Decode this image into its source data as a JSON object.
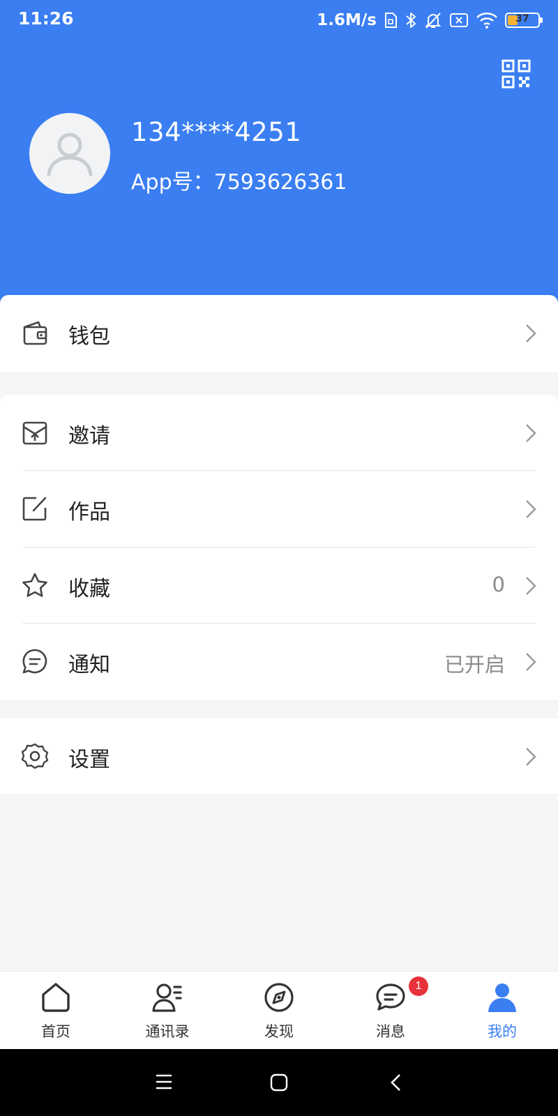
{
  "status_bar": {
    "time": "11:26",
    "network_speed": "1.6M/s",
    "battery_level": "37",
    "icons": [
      "sim-icon",
      "bluetooth-icon",
      "mute-icon",
      "no-sim-icon",
      "wifi-icon",
      "battery-icon"
    ]
  },
  "profile": {
    "phone": "134****4251",
    "app_id": "App号：7593626361",
    "qr_icon": "qr-code-icon",
    "avatar_icon": "user-placeholder-icon"
  },
  "menu": {
    "wallet": {
      "label": "钱包",
      "icon": "wallet-icon"
    },
    "invite": {
      "label": "邀请",
      "icon": "invite-icon"
    },
    "works": {
      "label": "作品",
      "icon": "edit-icon"
    },
    "favorites": {
      "label": "收藏",
      "value": "0",
      "icon": "star-icon"
    },
    "notifications": {
      "label": "通知",
      "value": "已开启",
      "icon": "chat-bubble-icon"
    },
    "settings": {
      "label": "设置",
      "icon": "gear-icon"
    }
  },
  "tabs": [
    {
      "label": "首页",
      "icon": "home-icon"
    },
    {
      "label": "通讯录",
      "icon": "contacts-icon"
    },
    {
      "label": "发现",
      "icon": "discover-icon"
    },
    {
      "label": "消息",
      "icon": "message-icon",
      "badge": "1"
    },
    {
      "label": "我的",
      "icon": "profile-icon",
      "active": true
    }
  ],
  "colors": {
    "primary": "#3a7ef2",
    "badge": "#e8323b",
    "background": "#f5f5f5"
  }
}
